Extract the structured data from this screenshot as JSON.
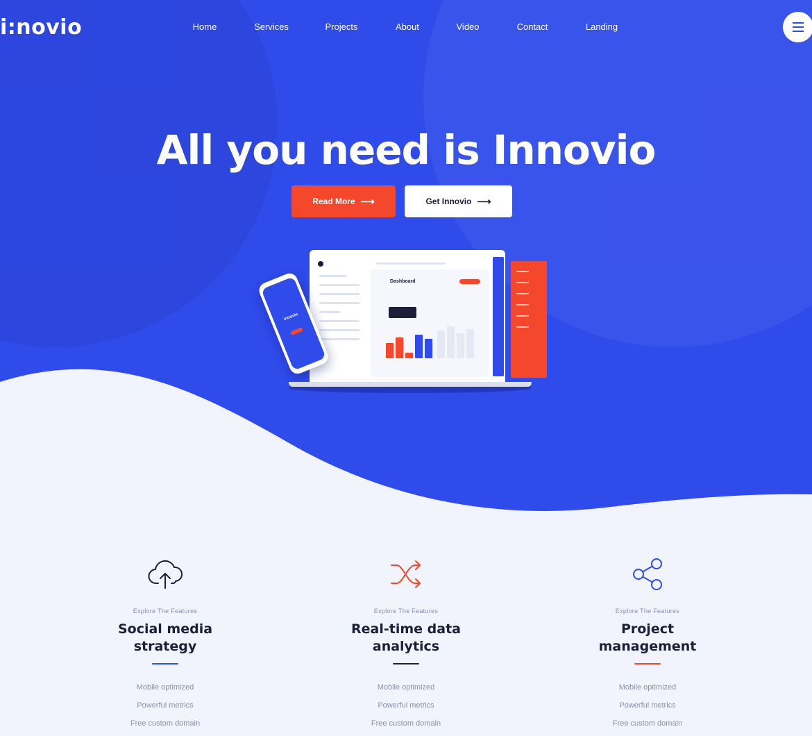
{
  "header": {
    "logo_text": "i:novio",
    "nav": [
      {
        "label": "Home"
      },
      {
        "label": "Services"
      },
      {
        "label": "Projects"
      },
      {
        "label": "About"
      },
      {
        "label": "Video"
      },
      {
        "label": "Contact"
      },
      {
        "label": "Landing"
      }
    ],
    "menu_icon": "hamburger-icon"
  },
  "hero": {
    "title": "All you need is Innovio",
    "primary_button": {
      "label": "Read More",
      "icon": "arrow-right-icon",
      "arrow": "⟶"
    },
    "secondary_button": {
      "label": "Get Innovio",
      "icon": "arrow-right-icon",
      "arrow": "⟶"
    },
    "mockup": {
      "dashboard_title": "Dashboard",
      "phone_brand": "innovio"
    }
  },
  "features": [
    {
      "icon": "cloud-upload-icon",
      "eyebrow": "Explore The Features",
      "title": "Social media strategy",
      "accent": "#2f4bea",
      "items": [
        "Mobile optimized",
        "Powerful metrics",
        "Free custom domain"
      ]
    },
    {
      "icon": "shuffle-icon",
      "eyebrow": "Explore The Features",
      "title": "Real-time data analytics",
      "accent": "#2f4bea",
      "items": [
        "Mobile optimized",
        "Powerful metrics",
        "Free custom domain"
      ]
    },
    {
      "icon": "share-icon",
      "eyebrow": "Explore The Features",
      "title": "Project management",
      "accent": "#f4472b",
      "items": [
        "Mobile optimized",
        "Powerful metrics",
        "Free custom domain"
      ]
    }
  ],
  "colors": {
    "brand_blue": "#2f4bea",
    "accent_red": "#f4472b",
    "dark_text": "#1d1e3a",
    "light_bg": "#f1f4fd"
  }
}
